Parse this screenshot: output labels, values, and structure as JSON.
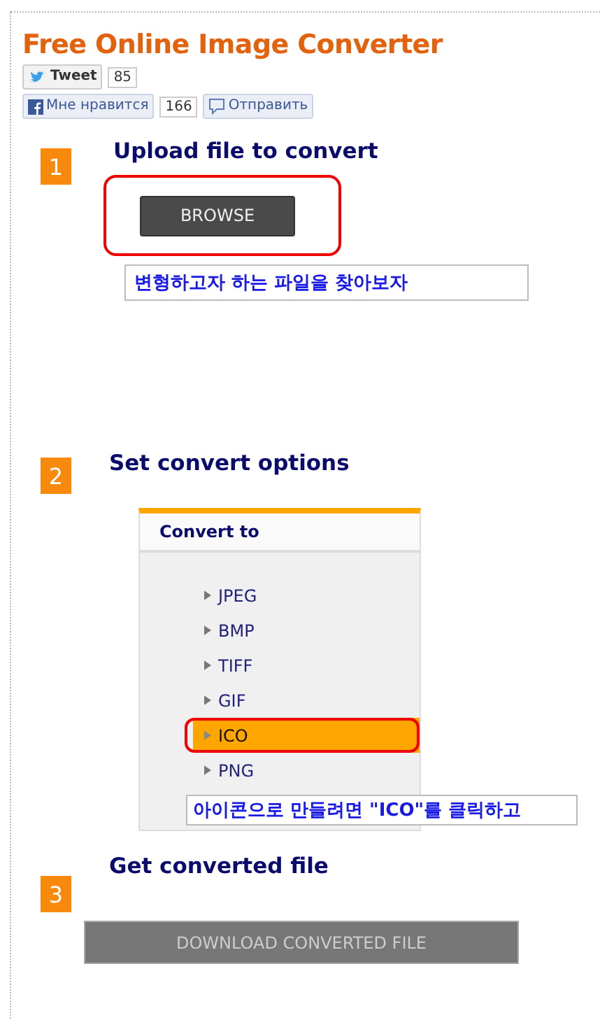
{
  "title": "Free Online Image Converter",
  "social": {
    "tweet_label": "Tweet",
    "tweet_count": "85",
    "like_label": "Мне нравится",
    "like_count": "166",
    "send_label": "Отправить"
  },
  "steps": [
    {
      "number": "1",
      "heading": "Upload file to convert",
      "kind": "upload",
      "button": "BROWSE",
      "note": "변형하고자 하는 파일을 찾아보자"
    },
    {
      "number": "2",
      "heading": "Set convert options",
      "kind": "options",
      "panel_title": "Convert to",
      "formats": [
        {
          "label": "JPEG",
          "selected": false
        },
        {
          "label": "BMP",
          "selected": false
        },
        {
          "label": "TIFF",
          "selected": false
        },
        {
          "label": "GIF",
          "selected": false
        },
        {
          "label": "ICO",
          "selected": true
        },
        {
          "label": "PNG",
          "selected": false
        }
      ],
      "note": "아이콘으로 만들려면 \"ICO\"를 클릭하고"
    },
    {
      "number": "3",
      "heading": "Get converted file",
      "kind": "download",
      "button": "DOWNLOAD CONVERTED FILE",
      "disabled": true
    }
  ]
}
